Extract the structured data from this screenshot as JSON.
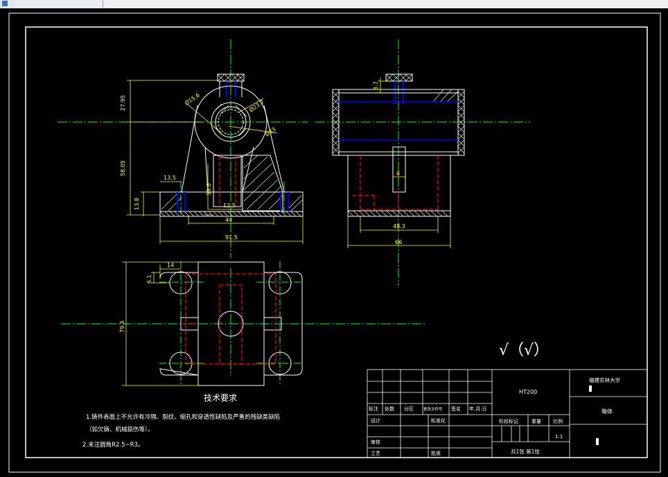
{
  "drawing": {
    "title": "技术要求",
    "notes": [
      "1.铸件表面上不允许有冷隔、裂纹、缩孔和穿透性缺陷及严重的残缺类缺陷",
      "（如欠铸、机械损伤等）。",
      "2.未注圆角R2.5~R3。"
    ],
    "surface_symbol": "√（√）",
    "dimensions": {
      "d1": "27.95",
      "d2": "Ø15.6",
      "d3": "Ø23.7",
      "d4": "Ø33",
      "d5": "58.05",
      "d6": "13.5",
      "d7": "13.8",
      "d8": "39.6",
      "d9": "12.5",
      "d10": "44",
      "d11": "91.5",
      "d12": "8.7",
      "d13": "8",
      "d14": "48.3",
      "d15": "66",
      "d16": "14",
      "d17": "6.1",
      "d18": "79.5"
    }
  },
  "title_block": {
    "material": "HT200",
    "school": "福建农林大学",
    "part_name": "箱体",
    "row_labels": [
      "标注",
      "处数",
      "分区",
      "更改文件号",
      "签名",
      "年.月.日"
    ],
    "design": "设计",
    "standard": "标准化",
    "stage_mark": "阶段标记",
    "weight": "重量",
    "scale_label": "比例",
    "scale": "1:1",
    "review": "审核",
    "process": "工艺",
    "approve": "批准",
    "sheet": "共1张 第1张"
  },
  "colors": {
    "background": "#000000",
    "outline": "#ffffff",
    "dimension": "#ffff00",
    "centerline": "#00ff00",
    "hidden": "#ff0000",
    "thread": "#0000ff"
  }
}
